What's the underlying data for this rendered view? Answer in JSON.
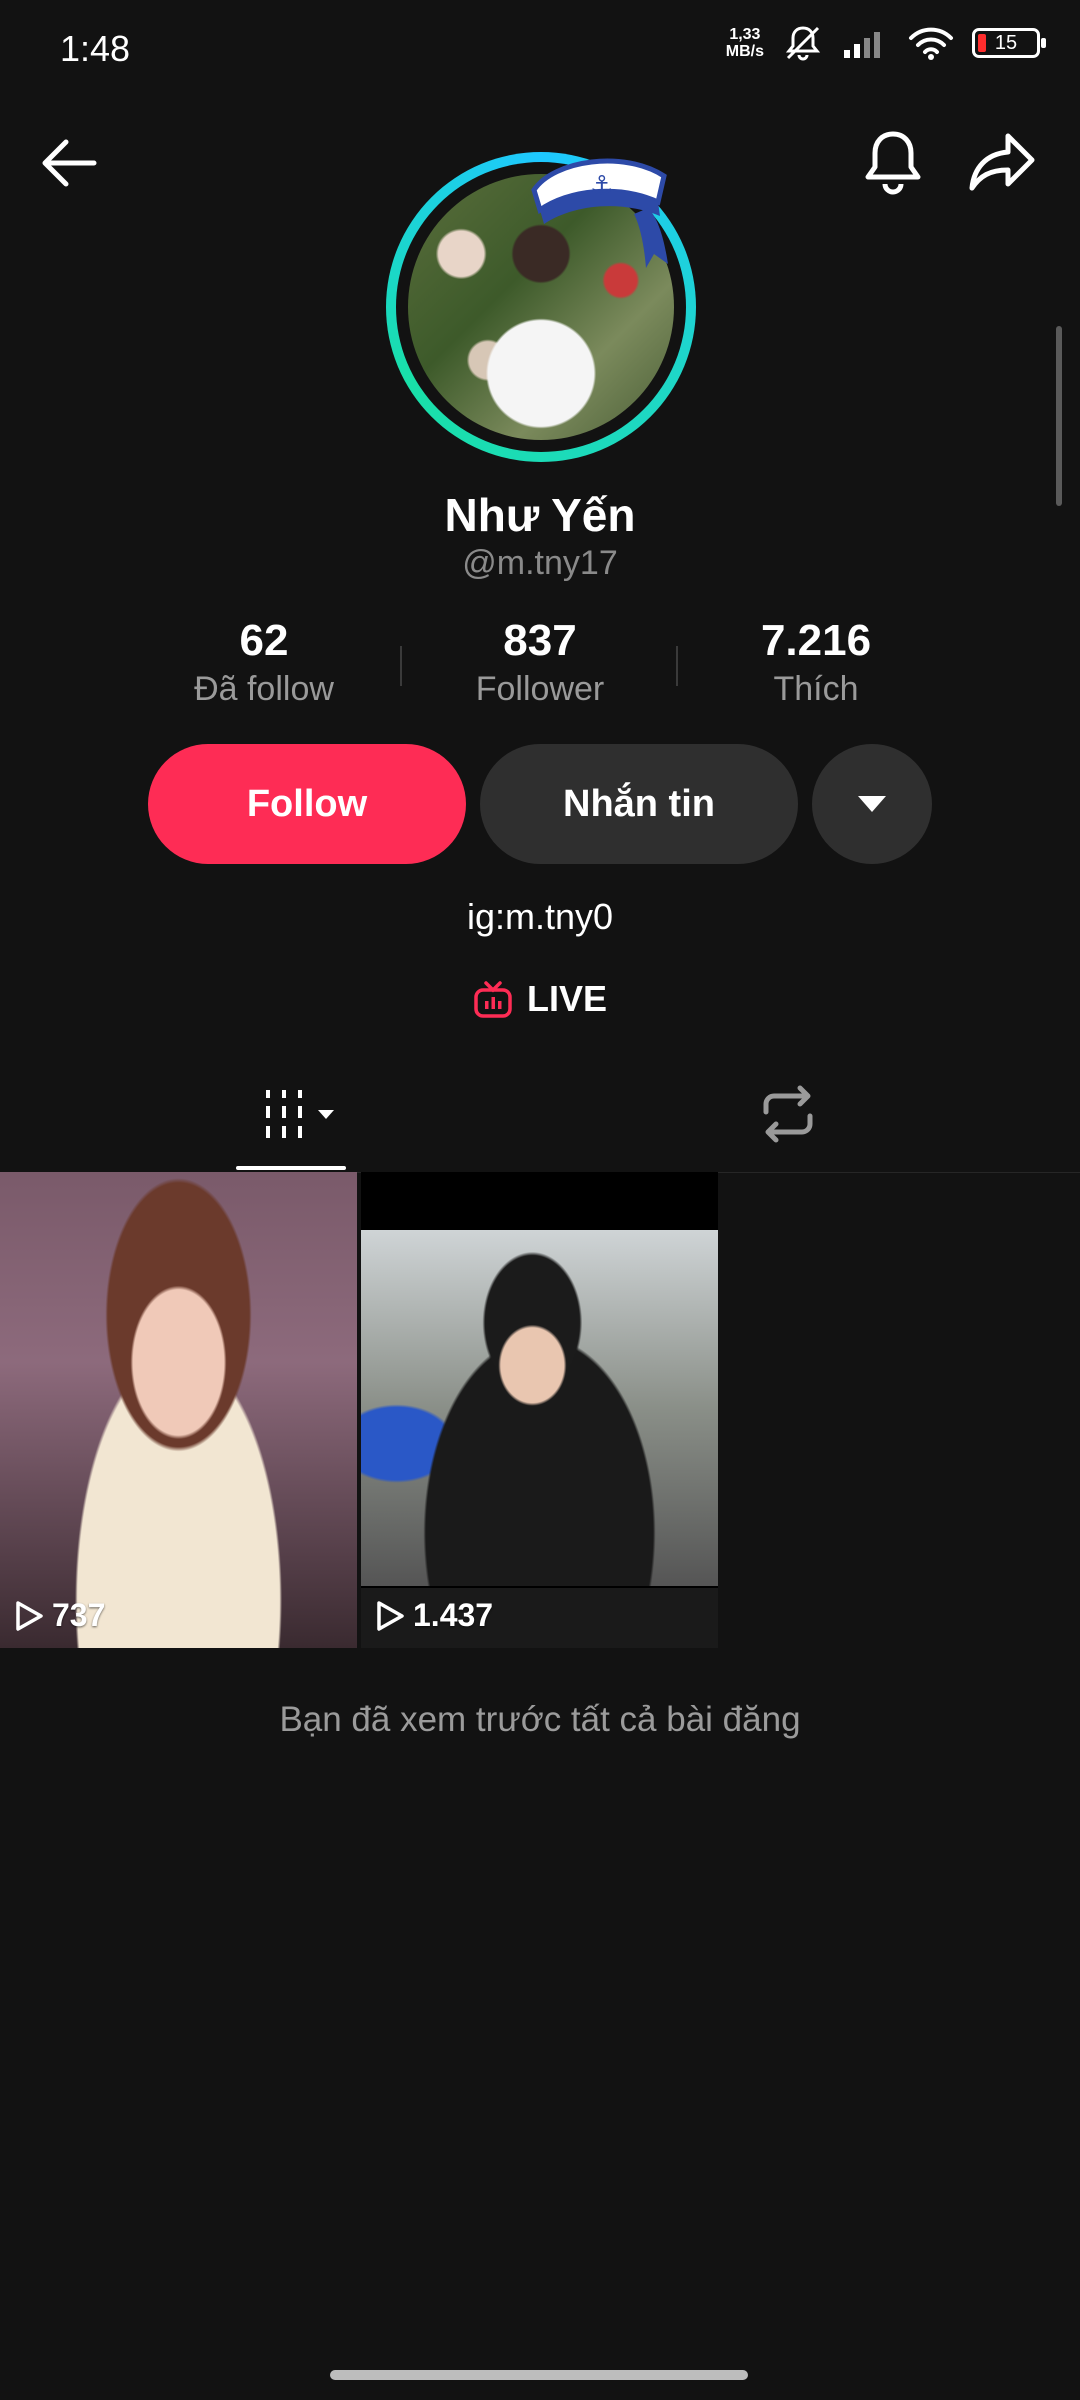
{
  "status_bar": {
    "time": "1:48",
    "net_speed_value": "1,33",
    "net_speed_unit": "MB/s",
    "battery_level": "15"
  },
  "nav": {
    "back_icon": "arrow-left-icon",
    "bell_icon": "bell-icon",
    "share_icon": "share-arrow-icon"
  },
  "profile": {
    "name": "Như Yến",
    "handle": "@m.tny17",
    "bio": "ig:m.tny0",
    "live_label": "LIVE"
  },
  "stats": [
    {
      "value": "62",
      "label": "Đã follow"
    },
    {
      "value": "837",
      "label": "Follower"
    },
    {
      "value": "7.216",
      "label": "Thích"
    }
  ],
  "actions": {
    "follow_label": "Follow",
    "message_label": "Nhắn tin"
  },
  "videos": [
    {
      "views": "737"
    },
    {
      "views": "1.437"
    }
  ],
  "end_note": "Bạn đã xem trước tất cả bài đăng",
  "colors": {
    "accent": "#fe2c55",
    "background": "#121212",
    "button_secondary": "#2f2f2f"
  }
}
